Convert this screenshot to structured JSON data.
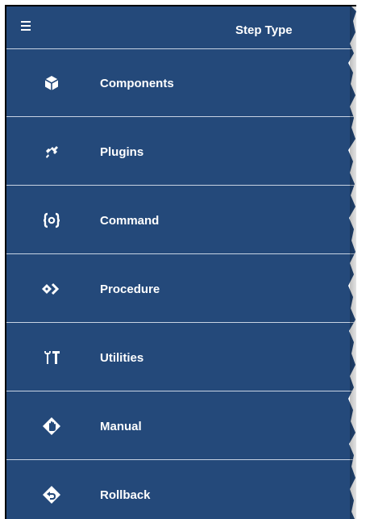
{
  "header": {
    "menu_icon": "hamburger-icon",
    "title": "Step Type"
  },
  "colors": {
    "panel_background": "#24497a",
    "divider": "#c8d3e3",
    "text": "#ffffff"
  },
  "items": [
    {
      "label": "Components",
      "icon": "cube-icon"
    },
    {
      "label": "Plugins",
      "icon": "plug-icon"
    },
    {
      "label": "Command",
      "icon": "curly-braces-icon"
    },
    {
      "label": "Procedure",
      "icon": "procedure-icon"
    },
    {
      "label": "Utilities",
      "icon": "tools-icon"
    },
    {
      "label": "Manual",
      "icon": "hand-icon"
    },
    {
      "label": "Rollback",
      "icon": "rollback-icon"
    }
  ]
}
